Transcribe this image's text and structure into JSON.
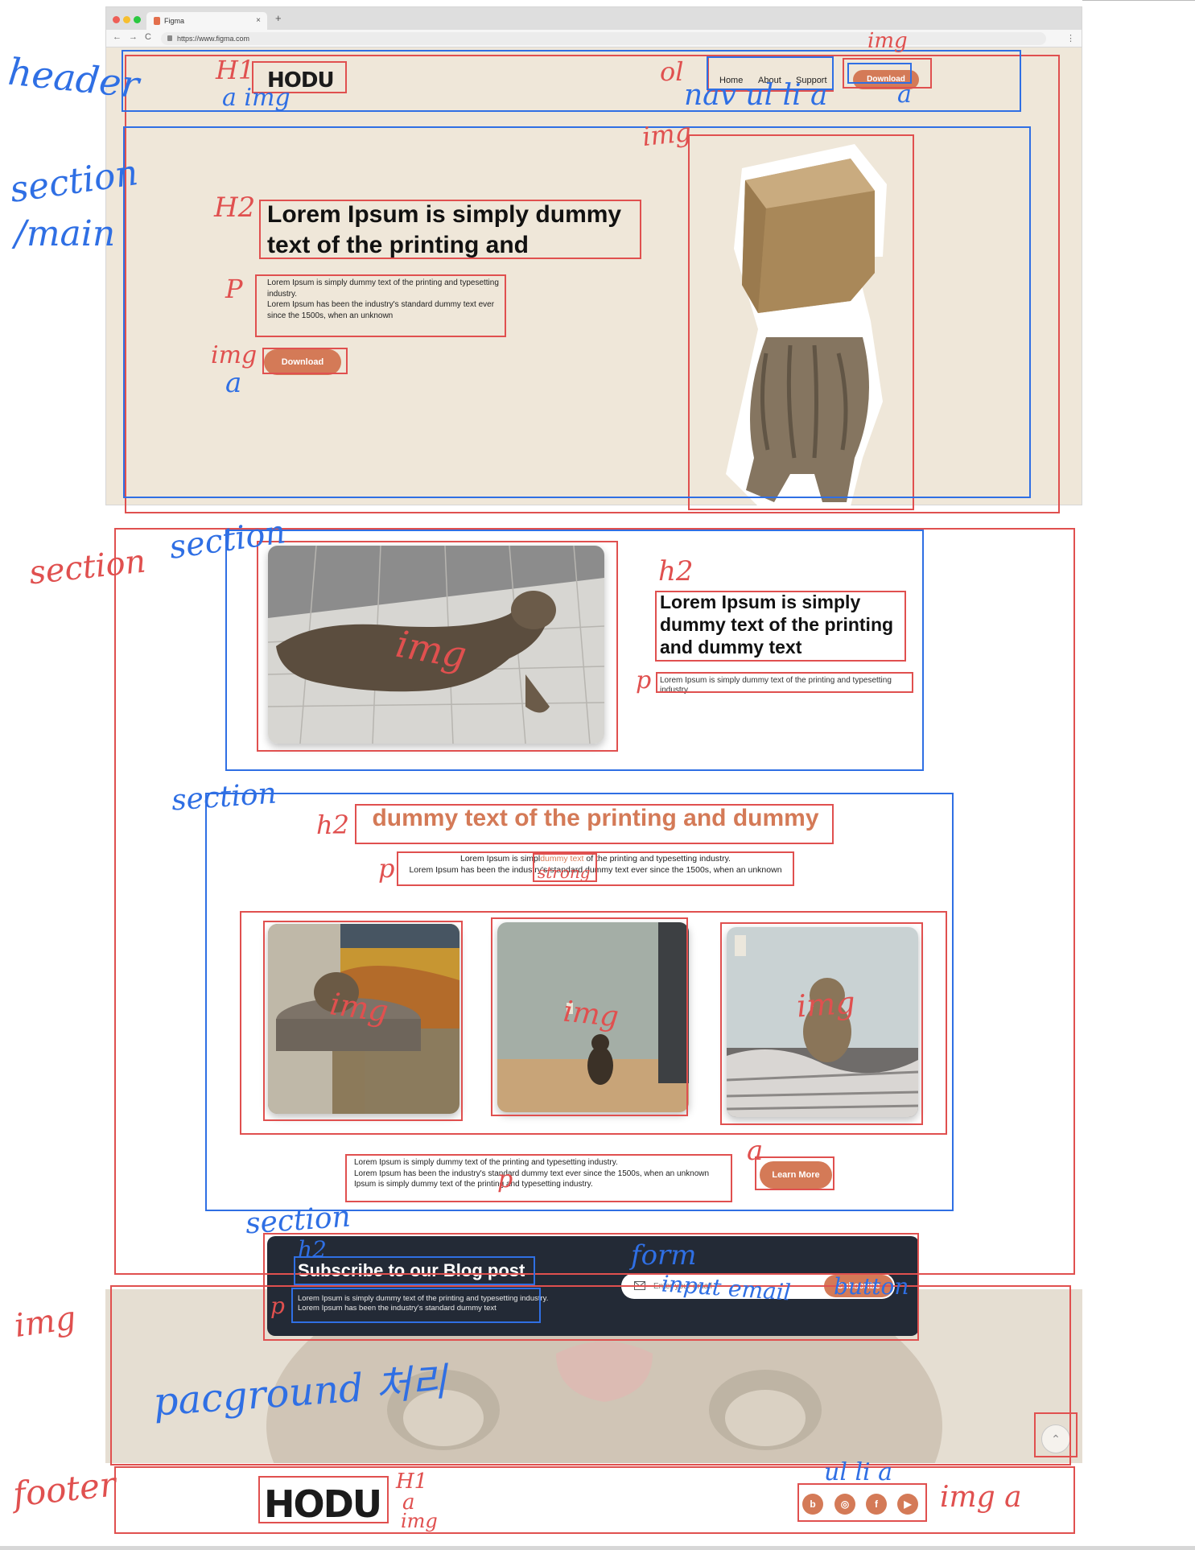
{
  "browser": {
    "tab_title": "Figma",
    "tab_close": "×",
    "new_tab": "+",
    "url": "https://www.figma.com",
    "back": "←",
    "forward": "→",
    "reload": "C",
    "menu": "⋮"
  },
  "header": {
    "logo": "HODU",
    "nav": [
      "Home",
      "About",
      "Support"
    ],
    "download_label": "Download"
  },
  "hero": {
    "title": "Lorem Ipsum is simply dummy text of the printing and",
    "paragraph": "Lorem Ipsum is simply dummy text of the printing and typesetting industry.\nLorem Ipsum has been the industry's standard dummy text ever since the 1500s, when an unknown",
    "download_label": "Download"
  },
  "section1": {
    "title": "Lorem Ipsum is simply dummy text of the printing and dummy text",
    "paragraph": "Lorem Ipsum is simply dummy text of the printing and typesetting industry."
  },
  "section2": {
    "title": "dummy text of the printing and dummy",
    "paragraph_line1_before": "Lorem Ipsum is simpl",
    "paragraph_highlight": "dummy text",
    "paragraph_line1_after": "of the printing and typesetting industry.",
    "paragraph_line2": "Lorem Ipsum has been the industry's standard dummy text ever since the 1500s, when an unknown",
    "footer_paragraph": "Lorem Ipsum is simply dummy text of the printing and typesetting industry.\nLorem Ipsum has been the industry's standard dummy text ever since the 1500s, when an unknown\nIpsum is simply dummy text of the printing and typesetting industry.",
    "learn_more_label": "Learn More"
  },
  "subscribe": {
    "title": "Subscribe to our Blog post",
    "paragraph": "Lorem Ipsum is simply dummy text of the printing and typesetting industry.\nLorem Ipsum has been the industry's standard dummy text",
    "placeholder": "Enter your email",
    "button_label": "Subscribe"
  },
  "footer": {
    "logo": "HODU",
    "social": [
      {
        "icon": "blog-icon",
        "glyph": "b"
      },
      {
        "icon": "instagram-icon",
        "glyph": "◎"
      },
      {
        "icon": "facebook-icon",
        "glyph": "f"
      },
      {
        "icon": "youtube-icon",
        "glyph": "▶"
      }
    ],
    "to_top": "⌃"
  },
  "annotations": {
    "header": "header",
    "section_main_1": "section",
    "section_main_2": "/main",
    "section_left": "section",
    "section_blue_1": "section",
    "section_blue_2": "section",
    "section_blue_3": "section",
    "img_left": "img",
    "footer_left": "footer",
    "h1": "H1",
    "h1_sub": "a  img",
    "ol": "ol",
    "nav_ul": "nav ul li a",
    "img_top": "img",
    "a_top": "a",
    "img_hero": "img",
    "h2_hero": "H2",
    "p_hero": "P",
    "img_a_hero_1": "img",
    "img_a_hero_2": "a",
    "h2_sec1": "h2",
    "p_sec1": "p",
    "img_sec1": "img",
    "h2_sec2": "h2",
    "p_sec2": "p",
    "strong": "strong",
    "img_card1": "img",
    "img_card2": "img",
    "img_card3": "img",
    "a_learn": "a",
    "p_learn": "p",
    "h2_sub": "h2",
    "form": "form",
    "input": "input email",
    "button": "button",
    "p_sub": "p",
    "background": "pacground 처리",
    "foot_h1_1": "H1",
    "foot_h1_2": "a",
    "foot_h1_3": "img",
    "foot_ul": "ul li a",
    "foot_img_a": "img  a"
  },
  "colors": {
    "accent": "#d47a57",
    "hero_bg": "#efe7d9",
    "subscribe_bg": "#232a36",
    "annotation_red": "#e0504f",
    "annotation_blue": "#2f6fe4"
  }
}
